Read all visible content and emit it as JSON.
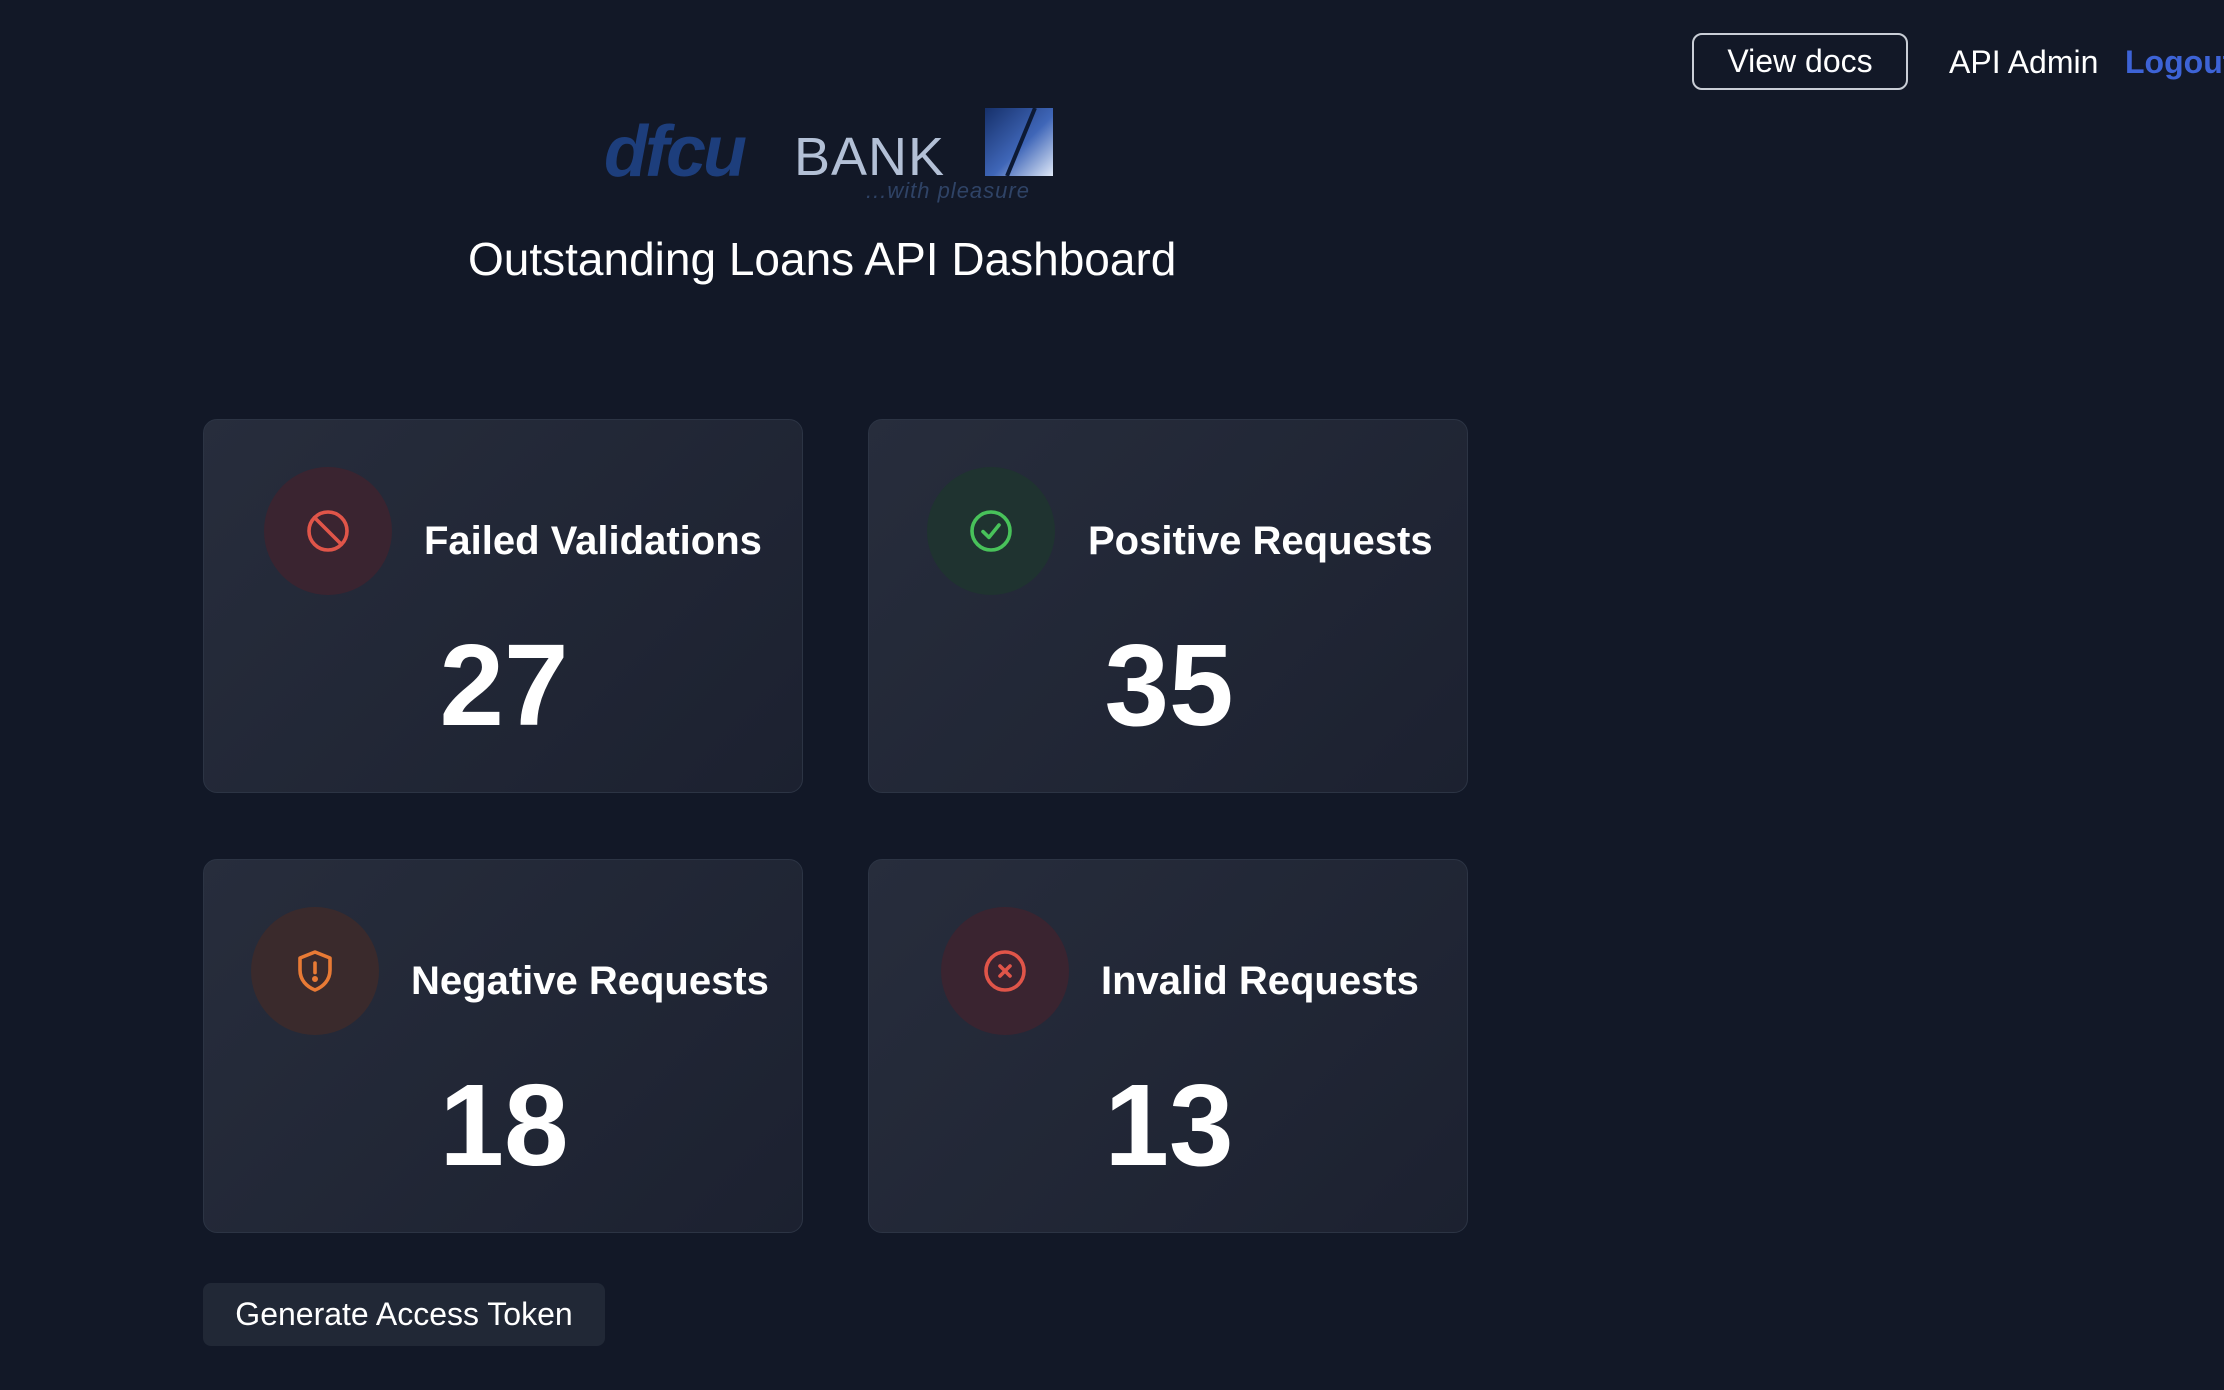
{
  "nav": {
    "view_docs_label": "View docs",
    "user_name": "API Admin",
    "logout_label": "Logout"
  },
  "logo": {
    "brand_main": "dfcu",
    "brand_suffix": "BANK",
    "tagline": "...with pleasure",
    "icon": "dfcu-logo-mark"
  },
  "page_title": "Outstanding Loans API Dashboard",
  "stats": [
    {
      "label": "Failed Validations",
      "value": "27",
      "icon": "ban-icon",
      "accent": "#e05549",
      "icon_bg": "#3a2430"
    },
    {
      "label": "Positive Requests",
      "value": "35",
      "icon": "check-circle-icon",
      "accent": "#48c25a",
      "icon_bg": "#1f3330"
    },
    {
      "label": "Negative Requests",
      "value": "18",
      "icon": "shield-alert-icon",
      "accent": "#e87a35",
      "icon_bg": "#3a2a2c"
    },
    {
      "label": "Invalid Requests",
      "value": "13",
      "icon": "x-circle-icon",
      "accent": "#e05549",
      "icon_bg": "#3a2430"
    }
  ],
  "actions": {
    "generate_token_label": "Generate Access Token"
  },
  "colors": {
    "background": "#121827",
    "card_background": "#242a39",
    "link": "#3d63d6",
    "brand_blue": "#1d3e7c"
  }
}
